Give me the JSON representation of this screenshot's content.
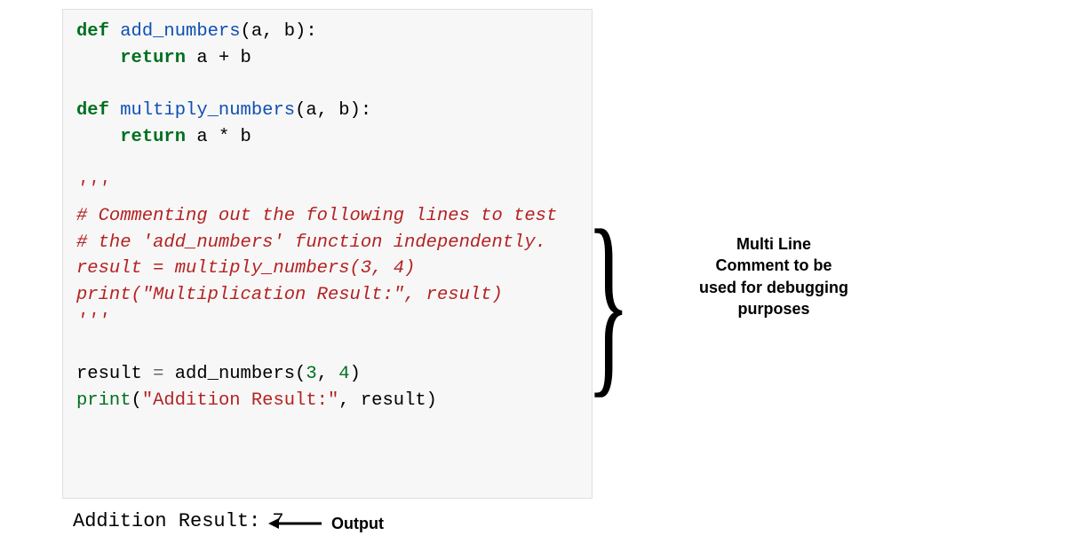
{
  "code": {
    "def1_kw": "def",
    "def1_name": "add_numbers",
    "def1_params": "(a, b):",
    "ret_kw": "return",
    "def1_body": "a + b",
    "def2_kw": "def",
    "def2_name": "multiply_numbers",
    "def2_params": "(a, b):",
    "def2_body": "a * b",
    "tri1": "'''",
    "comment1": "# Commenting out the following lines to test",
    "comment2": "# the 'add_numbers' function independently.",
    "line1_a": "result = multiply_numbers(",
    "line1_b": "3",
    "line1_c": ", ",
    "line1_d": "4",
    "line1_e": ")",
    "line2_a": "print(",
    "line2_str": "\"Multiplication Result:\"",
    "line2_b": ", result)",
    "tri2": "'''",
    "line3_a": "result ",
    "line3_eq": "=",
    "line3_b": " add_numbers(",
    "line3_c": "3",
    "line3_d": ", ",
    "line3_e": "4",
    "line3_f": ")",
    "line4_print": "print",
    "line4_a": "(",
    "line4_str": "\"Addition Result:\"",
    "line4_b": ", result)"
  },
  "output": {
    "text": "Addition Result: 7",
    "label": "Output"
  },
  "annotation": {
    "text": "Multi Line Comment to be used for debugging purposes"
  }
}
